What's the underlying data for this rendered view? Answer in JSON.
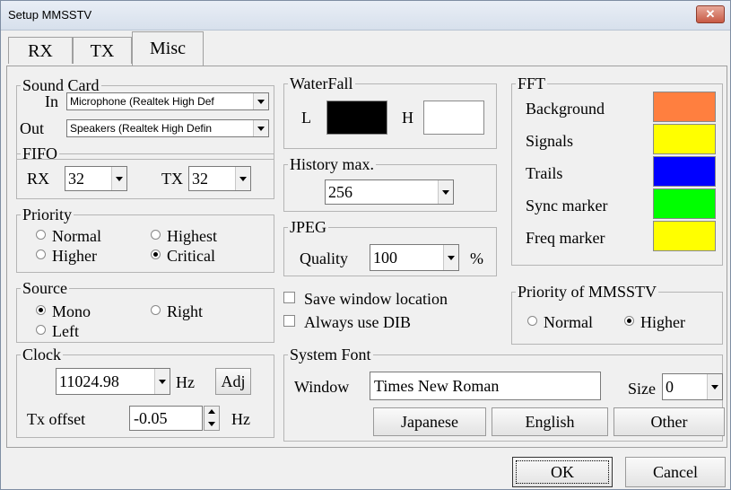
{
  "window": {
    "title": "Setup MMSSTV",
    "close_label": "✕"
  },
  "tabs": [
    {
      "label": "RX"
    },
    {
      "label": "TX"
    },
    {
      "label": "Misc"
    }
  ],
  "sound_card": {
    "legend": "Sound Card",
    "in_label": "In",
    "in_value": "Microphone (Realtek High Def",
    "out_label": "Out",
    "out_value": "Speakers (Realtek High Defin"
  },
  "fifo": {
    "legend": "FIFO",
    "rx_label": "RX",
    "rx_value": "32",
    "tx_label": "TX",
    "tx_value": "32"
  },
  "priority": {
    "legend": "Priority",
    "normal": "Normal",
    "highest": "Highest",
    "higher": "Higher",
    "critical": "Critical",
    "selected": "critical"
  },
  "source": {
    "legend": "Source",
    "mono": "Mono",
    "right": "Right",
    "left": "Left",
    "selected": "mono"
  },
  "clock": {
    "legend": "Clock",
    "value": "11024.98",
    "hz": "Hz",
    "adj": "Adj",
    "tx_offset_label": "Tx offset",
    "tx_offset_value": "-0.05",
    "tx_hz": "Hz"
  },
  "waterfall": {
    "legend": "WaterFall",
    "l_label": "L",
    "h_label": "H",
    "l_color": "#000000",
    "h_color": "#ffffff"
  },
  "history": {
    "legend": "History max.",
    "value": "256"
  },
  "jpeg": {
    "legend": "JPEG",
    "quality_label": "Quality",
    "quality_value": "100",
    "unit": "%"
  },
  "options": {
    "save_window_location": "Save window location",
    "always_use_dib": "Always use DIB",
    "save_checked": false,
    "dib_checked": false
  },
  "fft": {
    "legend": "FFT",
    "items": [
      {
        "label": "Background",
        "color": "#ff7f3f"
      },
      {
        "label": "Signals",
        "color": "#ffff00"
      },
      {
        "label": "Trails",
        "color": "#0000ff"
      },
      {
        "label": "Sync marker",
        "color": "#00ff00"
      },
      {
        "label": "Freq marker",
        "color": "#ffff00"
      }
    ]
  },
  "priority_mmsstv": {
    "legend": "Priority of MMSSTV",
    "normal": "Normal",
    "higher": "Higher",
    "selected": "higher"
  },
  "system_font": {
    "legend": "System Font",
    "window_label": "Window",
    "window_value": "Times New Roman",
    "size_label": "Size",
    "size_value": "0",
    "japanese": "Japanese",
    "english": "English",
    "other": "Other"
  },
  "footer": {
    "ok": "OK",
    "cancel": "Cancel"
  }
}
